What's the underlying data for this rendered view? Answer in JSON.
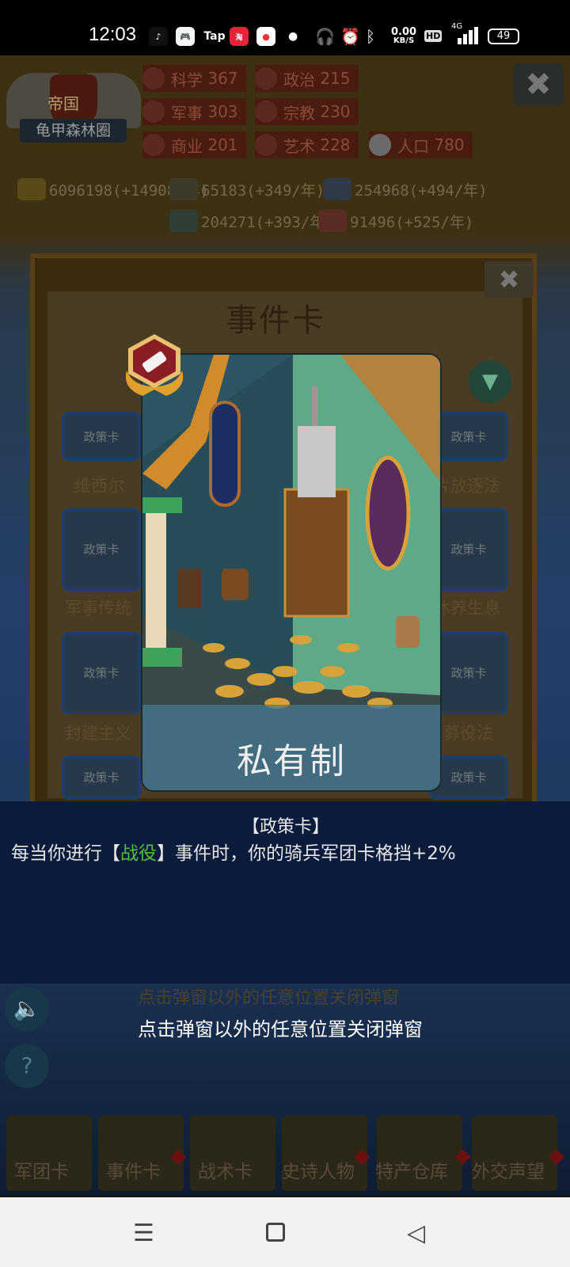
{
  "status_bar": {
    "time": "12:03",
    "apps": [
      "tiktok",
      "game-center",
      "Tap",
      "taobao",
      "red-app"
    ],
    "net_speed_value": "0.00",
    "net_speed_unit": "KB/S",
    "hd": "HD",
    "network": "4G",
    "battery": "49"
  },
  "empire": {
    "title": "帝国",
    "name": "龟甲森林圈"
  },
  "stats": [
    {
      "label": "科学",
      "value": "367"
    },
    {
      "label": "政治",
      "value": "215"
    },
    {
      "label": "军事",
      "value": "303"
    },
    {
      "label": "宗教",
      "value": "230"
    },
    {
      "label": "商业",
      "value": "201"
    },
    {
      "label": "艺术",
      "value": "228"
    },
    {
      "label": "人口",
      "value": "780"
    }
  ],
  "resources": [
    "6096198(+14908/年)",
    "65183(+349/年)",
    "254968(+494/年)",
    "204271(+393/年)",
    "91496(+525/年)"
  ],
  "panel": {
    "title": "事件卡",
    "card_tag": "政策卡",
    "cards_left": [
      "维西尔",
      "军事传统",
      "封建主义"
    ],
    "cards_right": [
      "片放逐法",
      "休养生息",
      "募役法"
    ]
  },
  "featured_card": {
    "name": "私有制",
    "type": "【政策卡】",
    "desc_prefix": "每当你进行【",
    "desc_keyword": "战役",
    "desc_suffix": "】事件时，你的骑兵军团卡格挡+2%"
  },
  "hint": "点击弹窗以外的任意位置关闭弹窗",
  "tabs": [
    "军团卡",
    "事件卡",
    "战术卡",
    "史诗人物",
    "特产仓库",
    "外交声望"
  ],
  "colors": {
    "keyword": "#4fbf3f",
    "info_band": "#0c1b3c"
  }
}
